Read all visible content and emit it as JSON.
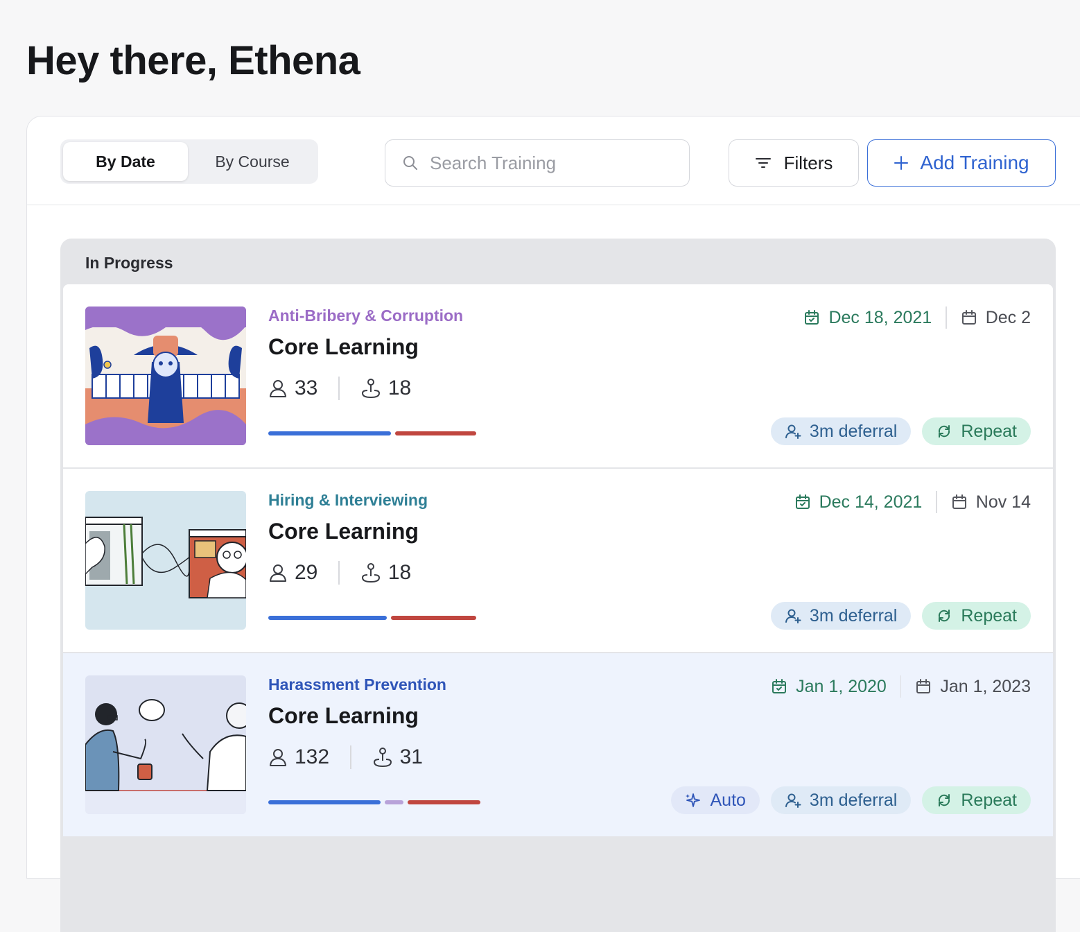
{
  "greeting": "Hey there, Ethena",
  "toolbar": {
    "view_toggle": [
      {
        "label": "By Date",
        "active": true
      },
      {
        "label": "By Course",
        "active": false
      }
    ],
    "search": {
      "placeholder": "Search Training",
      "value": ""
    },
    "filters_label": "Filters",
    "add_label": "Add Training",
    "accent_color": "#2f63d0"
  },
  "section": {
    "title": "In Progress",
    "trainings": [
      {
        "category": "Anti-Bribery & Corruption",
        "category_color": "#9b6cc6",
        "title": "Core Learning",
        "learners": "33",
        "completed": "18",
        "due_date": "Dec 18, 2021",
        "end_date": "Dec 2",
        "tags": [
          {
            "type": "deferral",
            "label": "3m deferral"
          },
          {
            "type": "repeat",
            "label": "Repeat"
          }
        ],
        "progress": [
          {
            "fraction": 0.59,
            "color": "#3a6fd8"
          },
          {
            "fraction": 0.39,
            "color": "#c0463f"
          }
        ],
        "thumbnail": "scarecrow-illustration"
      },
      {
        "category": "Hiring & Interviewing",
        "category_color": "#2e7f95",
        "title": "Core Learning",
        "learners": "29",
        "completed": "18",
        "due_date": "Dec 14, 2021",
        "end_date": "Nov 14",
        "tags": [
          {
            "type": "deferral",
            "label": "3m deferral"
          },
          {
            "type": "repeat",
            "label": "Repeat"
          }
        ],
        "progress": [
          {
            "fraction": 0.57,
            "color": "#3a6fd8"
          },
          {
            "fraction": 0.41,
            "color": "#c0463f"
          }
        ],
        "thumbnail": "video-call-illustration"
      },
      {
        "category": "Harassment Prevention",
        "category_color": "#2f55b8",
        "title": "Core Learning",
        "learners": "132",
        "completed": "31",
        "due_date": "Jan 1, 2020",
        "end_date": "Jan 1, 2023",
        "tags": [
          {
            "type": "auto",
            "label": "Auto"
          },
          {
            "type": "deferral",
            "label": "3m deferral"
          },
          {
            "type": "repeat",
            "label": "Repeat"
          }
        ],
        "progress": [
          {
            "fraction": 0.54,
            "color": "#3a6fd8"
          },
          {
            "fraction": 0.09,
            "color": "#b8a2d9"
          },
          {
            "fraction": 0.35,
            "color": "#c0463f"
          }
        ],
        "thumbnail": "conversation-illustration",
        "highlighted": true
      }
    ]
  },
  "icons": {
    "search": "search-icon",
    "filters": "filter-lines-icon",
    "add": "plus-icon",
    "learners": "person-icon",
    "completed": "joystick-icon",
    "due": "calendar-check-icon",
    "end": "calendar-icon",
    "deferral": "user-plus-icon",
    "repeat": "repeat-icon",
    "auto": "sparkle-icon"
  }
}
